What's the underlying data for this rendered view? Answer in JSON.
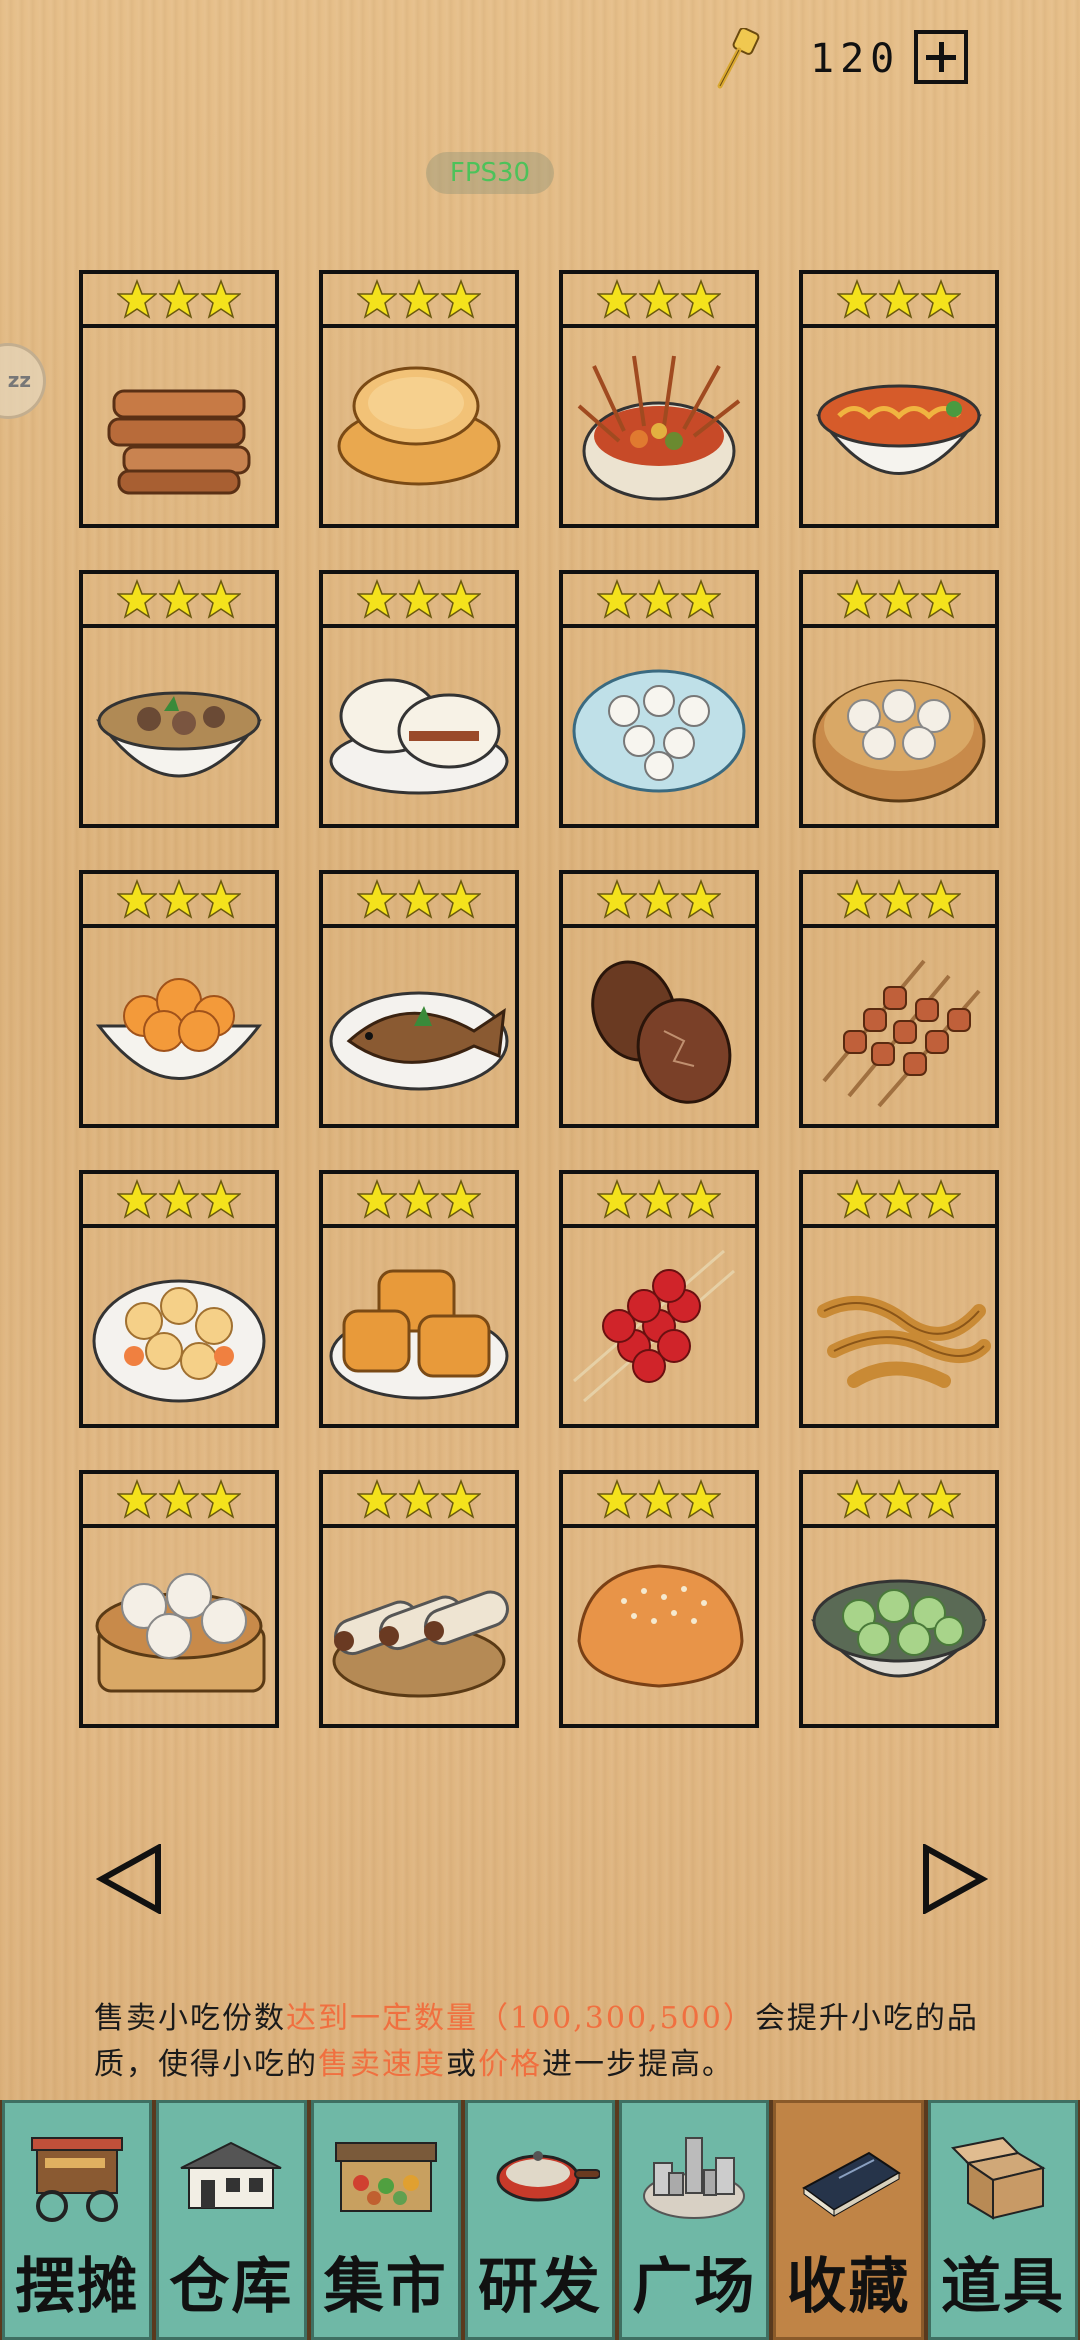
{
  "header": {
    "coins": "120",
    "fps": "FPS30",
    "side_tab_text": "zz"
  },
  "colors": {
    "star": "#f4e21c",
    "highlight": "#f07040",
    "nav_bg": "#6fb8a6",
    "nav_active": "#c08446"
  },
  "collection": [
    {
      "dish": "fried-dough-strips",
      "stars": 3
    },
    {
      "dish": "sesame-pancake",
      "stars": 3
    },
    {
      "dish": "skewer-hotpot",
      "stars": 3
    },
    {
      "dish": "noodle-bowl",
      "stars": 3
    },
    {
      "dish": "meatball-soup",
      "stars": 3
    },
    {
      "dish": "meat-buns",
      "stars": 3
    },
    {
      "dish": "rice-balls-soup",
      "stars": 3
    },
    {
      "dish": "steamed-dumplings",
      "stars": 3
    },
    {
      "dish": "fried-tofu-bowl",
      "stars": 3
    },
    {
      "dish": "braised-fish",
      "stars": 3
    },
    {
      "dish": "tea-eggs",
      "stars": 3
    },
    {
      "dish": "meat-skewers",
      "stars": 3
    },
    {
      "dish": "potato-chips-plate",
      "stars": 3
    },
    {
      "dish": "fried-tofu-plate",
      "stars": 3
    },
    {
      "dish": "candied-hawthorn",
      "stars": 3
    },
    {
      "dish": "fried-dough-twists",
      "stars": 3
    },
    {
      "dish": "steamer-buns",
      "stars": 3
    },
    {
      "dish": "spring-rolls",
      "stars": 3
    },
    {
      "dish": "sesame-bread",
      "stars": 3
    },
    {
      "dish": "green-rice-balls",
      "stars": 3
    }
  ],
  "tip": {
    "p1": "售卖小吃份数",
    "p2": "达到一定数量（100,300,500）",
    "p3": "会提升小吃的品质，使得小吃的",
    "p4": "售卖速度",
    "p5": "或",
    "p6": "价格",
    "p7": "进一步提高。"
  },
  "nav": [
    {
      "label": "摆摊",
      "icon": "food-cart-icon"
    },
    {
      "label": "仓库",
      "icon": "warehouse-icon"
    },
    {
      "label": "集市",
      "icon": "market-stall-icon"
    },
    {
      "label": "研发",
      "icon": "frying-pan-icon"
    },
    {
      "label": "广场",
      "icon": "city-square-icon"
    },
    {
      "label": "收藏",
      "icon": "book-icon",
      "active": true
    },
    {
      "label": "道具",
      "icon": "box-icon"
    }
  ]
}
